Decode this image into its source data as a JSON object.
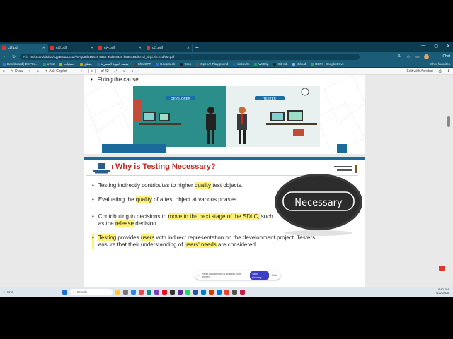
{
  "tabs": [
    {
      "label": "ct2.pdf",
      "active": true
    },
    {
      "label": "ct3.pdf",
      "active": false
    },
    {
      "label": "ct4.pdf",
      "active": false
    },
    {
      "label": "ct1.pdf",
      "active": false
    }
  ],
  "address": {
    "prefix": "File",
    "url": "C:/Users/abdou/AppData/Local/Temp/8d615446-5359-45d9-83c9-b939e43d6eed_depi.zip.eed/ct2.pdf"
  },
  "profile": {
    "copilot": "Chat"
  },
  "bookmarks": [
    {
      "label": "Dashboard | DEPI L...",
      "color": "#2f7bd6"
    },
    {
      "label": "uTest",
      "color": "#2c9e4b"
    },
    {
      "label": "حسابات",
      "color": "#d9a400"
    },
    {
      "label": "منطق",
      "color": "#d9a400"
    },
    {
      "label": "منصة الدولة المصرية",
      "color": "#2c6db0"
    },
    {
      "label": "ChatGPT",
      "color": "#444"
    },
    {
      "label": "DeepSeek",
      "color": "#3e6ae1"
    },
    {
      "label": "Grok",
      "color": "#222"
    },
    {
      "label": "OpenAI Playground",
      "color": "#555"
    },
    {
      "label": "LinkedIn",
      "color": "#0a66c2"
    },
    {
      "label": "Wattrip",
      "color": "#21a366"
    },
    {
      "label": "GitHub",
      "color": "#222"
    },
    {
      "label": "iCloud",
      "color": "#8ab4f8"
    },
    {
      "label": "DEPI - Google Drive",
      "color": "#34a853"
    }
  ],
  "bookmarks_other": "Other favorites",
  "pdf_toolbar": {
    "draw": "Draw",
    "ask_copilot": "Ask Copilot",
    "page_current": "9",
    "page_total": "of 42",
    "edit_acrobat": "Edit with Acrobat"
  },
  "page1": {
    "bullet": "Fixing the cause",
    "developer_label": "DEVELOPER",
    "tester_label": "TESTER"
  },
  "page2": {
    "title": "Why is Testing Necessary?",
    "bubble": "Necessary",
    "bullets": [
      {
        "parts": [
          {
            "t": "Testing indirectly contributes to higher "
          },
          {
            "t": "quality",
            "hl": true
          },
          {
            "t": " test objects."
          }
        ]
      },
      {
        "parts": [
          {
            "t": "Evaluating the "
          },
          {
            "t": "quality",
            "hl": true
          },
          {
            "t": " of a test object at various phases."
          }
        ]
      },
      {
        "parts": [
          {
            "t": "Contributing to decisions to "
          },
          {
            "t": "move to the next stage of the SDLC,",
            "hl": true
          },
          {
            "t": " such as the "
          },
          {
            "t": "release",
            "hl": true
          },
          {
            "t": " decision."
          }
        ]
      },
      {
        "parts": [
          {
            "t": "Testing",
            "hl": true
          },
          {
            "t": " provides "
          },
          {
            "t": "users",
            "hl": true
          },
          {
            "t": " with indirect representation on the development project. Testers ensure that their understanding of "
          },
          {
            "t": "users' needs",
            "hl": true
          },
          {
            "t": " are considered."
          }
        ]
      }
    ]
  },
  "sharing": {
    "text": "meet.google.com is sharing your screen.",
    "stop": "Stop sharing",
    "hide": "Hide"
  },
  "taskbar": {
    "search": "Search",
    "weather_temp": "33°C",
    "weather_desc": "",
    "time": "8:42 PM",
    "date": "6/22/2025"
  }
}
